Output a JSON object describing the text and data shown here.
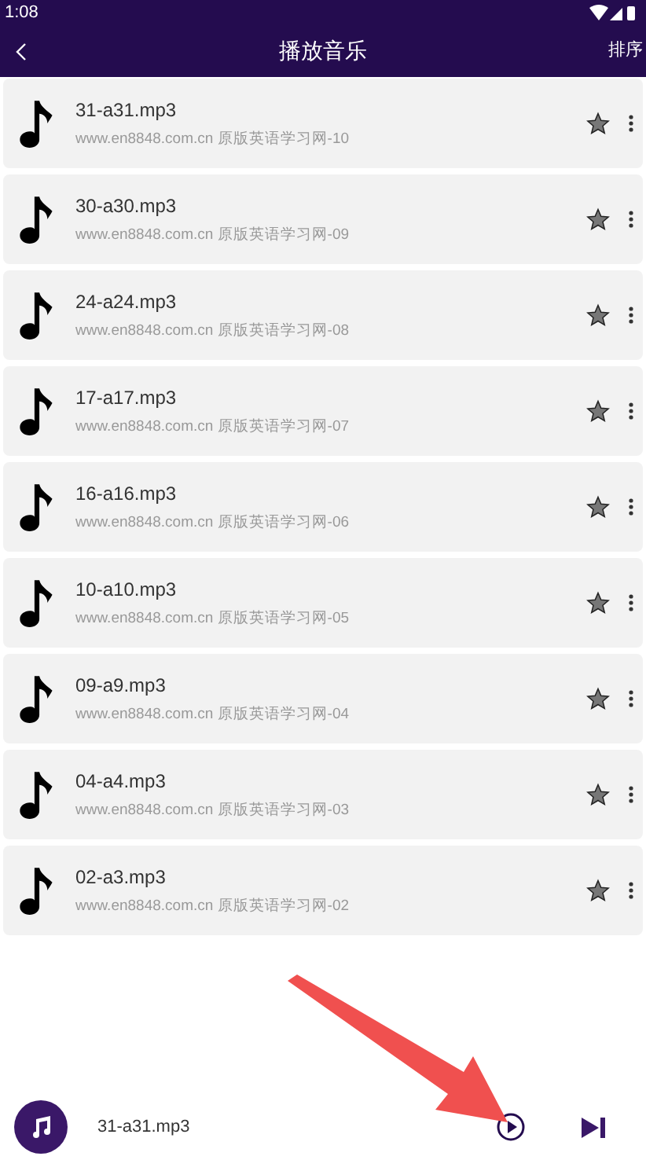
{
  "status_bar": {
    "time": "1:08"
  },
  "header": {
    "title": "播放音乐",
    "action": "排序"
  },
  "tracks": [
    {
      "title": "31-a31.mp3",
      "subtitle": "www.en8848.com.cn 原版英语学习网-10",
      "starred": false
    },
    {
      "title": "30-a30.mp3",
      "subtitle": "www.en8848.com.cn 原版英语学习网-09",
      "starred": false
    },
    {
      "title": "24-a24.mp3",
      "subtitle": "www.en8848.com.cn 原版英语学习网-08",
      "starred": false
    },
    {
      "title": "17-a17.mp3",
      "subtitle": "www.en8848.com.cn 原版英语学习网-07",
      "starred": false
    },
    {
      "title": "16-a16.mp3",
      "subtitle": "www.en8848.com.cn 原版英语学习网-06",
      "starred": false
    },
    {
      "title": "10-a10.mp3",
      "subtitle": "www.en8848.com.cn 原版英语学习网-05",
      "starred": false
    },
    {
      "title": "09-a9.mp3",
      "subtitle": "www.en8848.com.cn 原版英语学习网-04",
      "starred": false
    },
    {
      "title": "04-a4.mp3",
      "subtitle": "www.en8848.com.cn 原版英语学习网-03",
      "starred": false
    },
    {
      "title": "02-a3.mp3",
      "subtitle": "www.en8848.com.cn 原版英语学习网-02",
      "starred": false
    }
  ],
  "player": {
    "now_playing": "31-a31.mp3"
  }
}
